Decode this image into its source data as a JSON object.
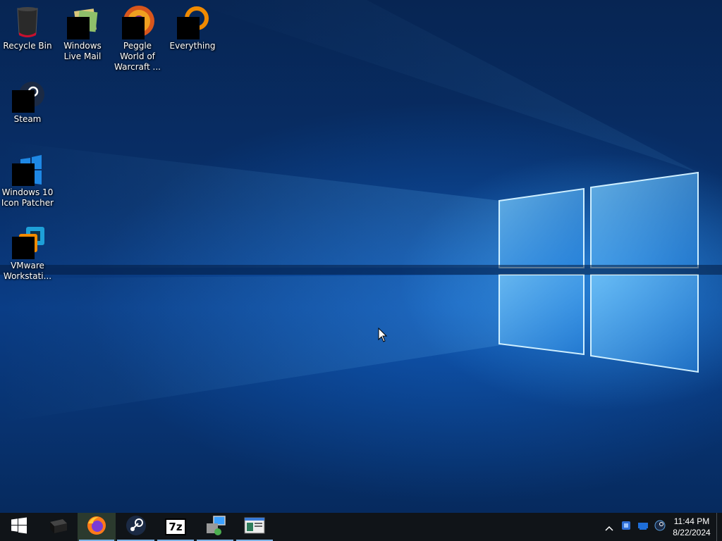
{
  "desktop": {
    "icons": [
      {
        "label": "Recycle Bin",
        "icon": "recycle-bin-icon"
      },
      {
        "label": "Windows Live Mail",
        "icon": "windows-live-mail-icon"
      },
      {
        "label": "Peggle World of Warcraft ...",
        "icon": "peggle-icon"
      },
      {
        "label": "Everything",
        "icon": "everything-search-icon"
      },
      {
        "label": "Steam",
        "icon": "steam-icon"
      },
      {
        "label": "Windows 10 Icon Patcher",
        "icon": "windows-10-icon-patcher-icon"
      },
      {
        "label": "VMware Workstati...",
        "icon": "vmware-workstation-icon"
      }
    ]
  },
  "taskbar": {
    "start": {
      "icon": "windows-start-icon"
    },
    "pinned": [
      {
        "icon": "terminal-app-icon",
        "running": false,
        "active": false
      },
      {
        "icon": "firefox-icon",
        "running": true,
        "active": true
      },
      {
        "icon": "steam-icon",
        "running": true,
        "active": false
      },
      {
        "icon": "7zip-icon",
        "text": "7z",
        "running": true,
        "active": false
      },
      {
        "icon": "network-install-icon",
        "running": true,
        "active": false
      },
      {
        "icon": "document-window-icon",
        "running": true,
        "active": false
      }
    ],
    "tray": {
      "icons": [
        "chevron-up-icon",
        "tray-app-icon",
        "network-icon",
        "steam-tray-icon"
      ],
      "time": "11:44 PM",
      "date": "8/22/2024"
    }
  },
  "colors": {
    "taskbar_bg": "#101418",
    "accent": "#3aa0ff",
    "running_indicator": "#7db4e6"
  }
}
